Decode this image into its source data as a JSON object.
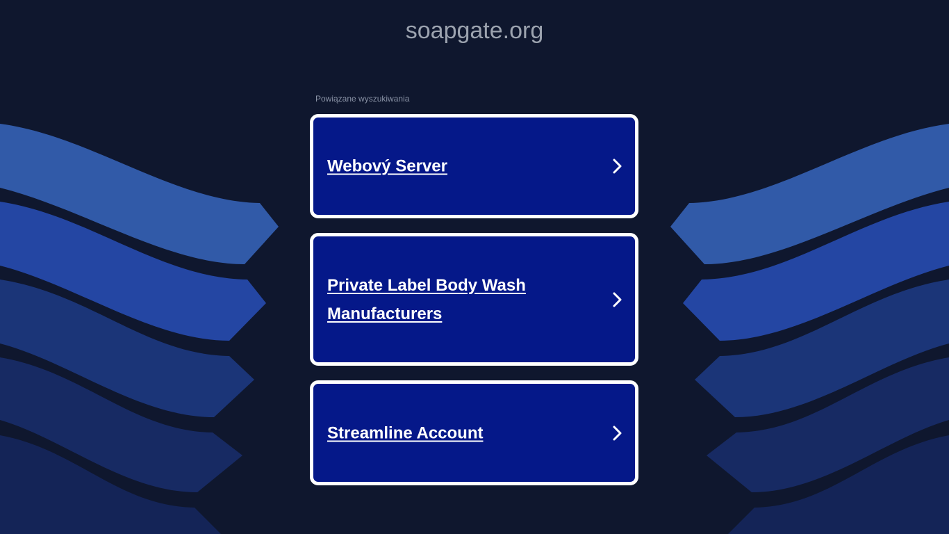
{
  "page": {
    "domain_title": "soapgate.org",
    "related_label": "Powiązane wyszukiwania"
  },
  "links": [
    {
      "label": "Webový Server",
      "icon": "chevron-right-icon"
    },
    {
      "label": "Private Label Body Wash Manufacturers",
      "icon": "chevron-right-icon"
    },
    {
      "label": "Streamline Account",
      "icon": "chevron-right-icon"
    }
  ],
  "colors": {
    "background": "#0f172e",
    "card_background": "#051889",
    "card_border": "#ffffff",
    "title_text": "#9ca3af",
    "wave_light": "#315aa8",
    "wave_mid": "#2446a3",
    "wave_dark": "#1b3578",
    "wave_darker": "#172a63"
  }
}
